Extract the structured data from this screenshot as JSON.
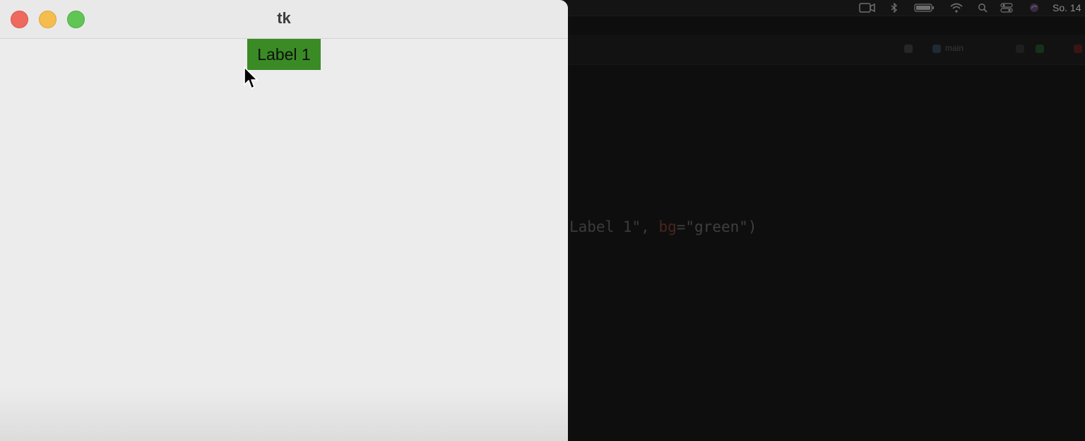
{
  "window": {
    "title": "tk"
  },
  "label": {
    "text": "Label 1",
    "bg_color": "#3a8b25"
  },
  "background_ide": {
    "code_line_prefix": "Label 1\",",
    "code_line_kw": "bg",
    "code_line_suffix": "=\"green\")",
    "branch": "main"
  },
  "menubar": {
    "clock": "So. 14"
  },
  "icons": {
    "close": "close-traffic-light",
    "minimize": "minimize-traffic-light",
    "maximize": "maximize-traffic-light",
    "cursor": "arrow-cursor-icon"
  },
  "colors": {
    "close": "#ee6a5e",
    "minimize": "#f5bd4f",
    "maximize": "#61c555",
    "window_bg": "#ececec",
    "desktop_bg": "#111111"
  }
}
